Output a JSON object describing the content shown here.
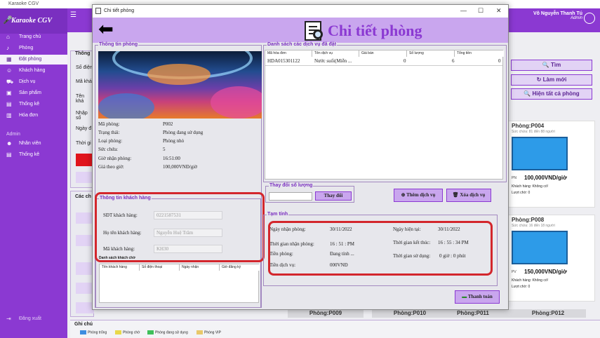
{
  "app": {
    "title": "Karaoke CGV"
  },
  "sidebar": {
    "brand": "Karaoke CGV",
    "items": [
      {
        "label": "Trang chủ",
        "icon": "home-icon"
      },
      {
        "label": "Phòng",
        "icon": "mic-icon"
      },
      {
        "label": "Đặt phòng",
        "icon": "calendar-icon"
      },
      {
        "label": "Khách hàng",
        "icon": "users-icon"
      },
      {
        "label": "Dịch vụ",
        "icon": "truck-icon"
      },
      {
        "label": "Sản phẩm",
        "icon": "box-icon"
      },
      {
        "label": "Thống kê",
        "icon": "chart-icon"
      },
      {
        "label": "Hóa đơn",
        "icon": "invoice-icon"
      }
    ],
    "admin_head": "Admin",
    "admin_items": [
      {
        "label": "Nhân viên",
        "icon": "staff-icon"
      },
      {
        "label": "Thống kê",
        "icon": "chart-icon"
      }
    ],
    "logout": "Đăng xuất"
  },
  "topbar": {
    "user_name": "Võ Nguyễn Thanh Tú",
    "role": "Admin"
  },
  "background": {
    "form_title": "Thông",
    "form_labels": [
      "Số điện",
      "Mã khá",
      "Tên khá",
      "Nhập số",
      "Ngày đ",
      "Thời gi"
    ],
    "actions_title": "Các ch",
    "btn_search": "Tìm",
    "btn_refresh": "Làm mới",
    "btn_show_all": "Hiện tất cả phòng",
    "rooms": [
      {
        "name": "Phòng:P004",
        "capacity": "Sức chứa: 81 đến 88 người",
        "type": "PN",
        "price": "100,000VND/giờ",
        "customer": "Khách hàng:  Không có!",
        "count": "Lượt chờ:  0"
      },
      {
        "name": "Phòng:P008",
        "capacity": "Sức chứa: 16 đến 18 người",
        "type": "PV",
        "price": "150,000VND/giờ",
        "customer": "Khách hàng:  Không có!",
        "count": "Lượt chờ:  0"
      }
    ],
    "bottom_rooms": [
      "Phòng:P009",
      "Phòng:P010",
      "Phòng:P011",
      "Phòng:P012"
    ],
    "legend_title": "Ghi chú",
    "legend": [
      {
        "label": "Phòng trống",
        "color": "#3d8de0"
      },
      {
        "label": "Phòng chờ",
        "color": "#e8d84a"
      },
      {
        "label": "Phòng đang sử dụng",
        "color": "#3fbf5a"
      },
      {
        "label": "Phòng VIP",
        "color": "#e8c86a"
      }
    ]
  },
  "dialog": {
    "window_title": "Chi tiết phòng",
    "heading": "Chi tiết phòng",
    "room_info": {
      "caption": "Thông tin phòng",
      "rows": [
        {
          "label": "Mã phòng:",
          "value": "P002"
        },
        {
          "label": "Trạng thái:",
          "value": "Phòng đang sử dụng"
        },
        {
          "label": "Loại phòng:",
          "value": "Phòng nhỏ"
        },
        {
          "label": "Sức chứa:",
          "value": "5"
        },
        {
          "label": "Giờ nhận phòng:",
          "value": "16:51:00"
        },
        {
          "label": "Giá theo giờ:",
          "value": "100,000VNĐ/giờ"
        }
      ]
    },
    "customer_info": {
      "caption": "Thông tin khách hàng",
      "phone_label": "SĐT khách hàng:",
      "phone_value": "0221587531",
      "name_label": "Họ tên khách hàng:",
      "name_value": "Nguyễn Huệ Trâm",
      "id_label": "Mã khách hàng:",
      "id_value": "KH30",
      "waiting_title": "Danh sách khách chờ",
      "waiting_columns": [
        "Tên khách hàng",
        "Số điện thoại",
        "Ngày nhận",
        "Giờ đăng ký"
      ]
    },
    "services": {
      "caption": "Danh sách các dịch vụ đã đặt",
      "columns": [
        "Mã hóa đơn",
        "Tên dịch vụ",
        "Giá bán",
        "Số lượng",
        "Tổng tiền"
      ],
      "rows": [
        {
          "invoice": "HDA015301122",
          "name": "Nước suối(Miễn ...",
          "price": "0",
          "qty": "6",
          "total": "0"
        }
      ]
    },
    "change_qty": {
      "caption": "Thay đổi số lượng",
      "value": "",
      "button": "Thay đổi"
    },
    "btn_add_service": "Thêm dịch vụ",
    "btn_delete_service": "Xóa dịch vụ",
    "summary": {
      "caption": "Tạm tính",
      "checkin_date_label": "Ngày nhận phòng:",
      "checkin_date": "30/11/2022",
      "checkin_time_label": "Thời gian nhận phòng:",
      "checkin_time": "16 : 51 : PM",
      "room_fee_label": "Tiền phòng:",
      "room_fee": "Đang tính ...",
      "service_fee_label": "Tiền dịch vụ:",
      "service_fee": "000VNĐ",
      "current_date_label": "Ngày hiện tại:",
      "current_date": "30/11/2022",
      "end_time_label": "Thời gian kết thúc:",
      "end_time": "16 : 55 : 34 PM",
      "used_label": "Thời gian sử dụng:",
      "used": "0  giờ  :  0  phút"
    },
    "btn_pay": "Thanh toán"
  }
}
